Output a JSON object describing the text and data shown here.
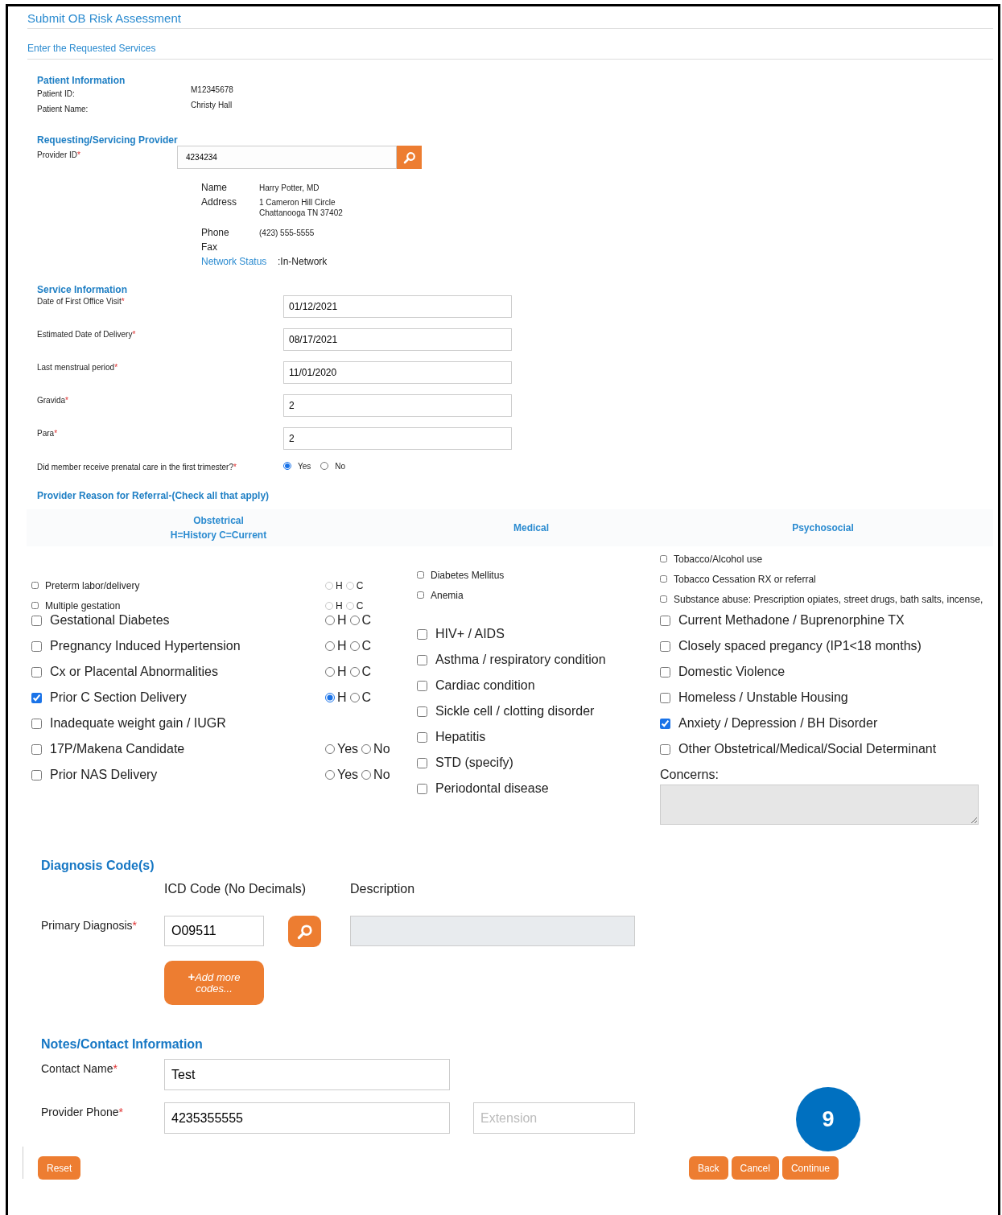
{
  "header": {
    "title": "Submit OB Risk Assessment",
    "subtitle": "Enter the Requested Services"
  },
  "patient": {
    "heading": "Patient Information",
    "fields": [
      {
        "label": "Patient ID:",
        "value": "M12345678"
      },
      {
        "label": "Patient Name:",
        "value": "Christy Hall"
      }
    ]
  },
  "provider": {
    "heading": "Requesting/Servicing Provider",
    "id_field": {
      "label": "Provider ID",
      "mark": "*",
      "value": "4234234"
    },
    "details": [
      {
        "kind": "plain",
        "label": "Name",
        "lines": [
          "Harry Potter, MD"
        ]
      },
      {
        "kind": "plain",
        "label": "Address",
        "lines": [
          "1 Cameron Hill Circle",
          "Chattanooga TN 37402"
        ]
      },
      {
        "kind": "plain",
        "label": "Phone",
        "lines": [
          "(423) 555-5555"
        ]
      },
      {
        "kind": "plain",
        "label": "Fax"
      },
      {
        "kind": "status",
        "label": "Network Status",
        "lines": [
          ":In-Network"
        ]
      }
    ]
  },
  "service": {
    "heading": "Service Information",
    "fields": [
      {
        "label": "Date of First Office Visit",
        "mark": "*",
        "value": "01/12/2021"
      },
      {
        "label": "Estimated Date of Delivery",
        "mark": "*",
        "value": "08/17/2021"
      },
      {
        "label": "Last menstrual period",
        "mark": "*",
        "value": "11/01/2020"
      },
      {
        "label": "Gravida",
        "mark": "*",
        "value": "2"
      },
      {
        "label": "Para",
        "mark": "*",
        "value": "2"
      }
    ],
    "question": {
      "label": "Did member receive prenatal care in the first trimester?",
      "mark": "*",
      "options": [
        {
          "label": "Yes",
          "selected": true
        },
        {
          "label": "No",
          "selected": false
        }
      ]
    }
  },
  "referral": {
    "heading": "Provider Reason for Referral-(Check all that apply)",
    "columns": [
      {
        "title_lines": [
          "Obstetrical",
          "H=History C=Current"
        ],
        "items": [
          {
            "kind": "small",
            "label": "Preterm labor/delivery",
            "checked": false,
            "options": [
              {
                "label": "H",
                "selected": false
              },
              {
                "label": "C",
                "selected": false
              }
            ]
          },
          {
            "kind": "small",
            "label": "Multiple gestation",
            "checked": false,
            "options": [
              {
                "label": "H",
                "selected": false
              },
              {
                "label": "C",
                "selected": false
              }
            ]
          },
          {
            "kind": "large",
            "label": "Gestational Diabetes",
            "checked": false,
            "options": [
              {
                "label": "H",
                "selected": false
              },
              {
                "label": "C",
                "selected": false
              }
            ]
          },
          {
            "kind": "large",
            "label": "Pregnancy Induced Hypertension",
            "checked": false,
            "options": [
              {
                "label": "H",
                "selected": false
              },
              {
                "label": "C",
                "selected": false
              }
            ]
          },
          {
            "kind": "large",
            "label": "Cx or Placental Abnormalities",
            "checked": false,
            "options": [
              {
                "label": "H",
                "selected": false
              },
              {
                "label": "C",
                "selected": false
              }
            ]
          },
          {
            "kind": "large",
            "label": "Prior C Section Delivery",
            "checked": true,
            "options": [
              {
                "label": "H",
                "selected": true
              },
              {
                "label": "C",
                "selected": false
              }
            ]
          },
          {
            "kind": "large",
            "label": "Inadequate weight gain / IUGR",
            "checked": false
          },
          {
            "kind": "large",
            "label": "17P/Makena Candidate",
            "checked": false,
            "options": [
              {
                "label": "Yes",
                "selected": false
              },
              {
                "label": "No",
                "selected": false
              }
            ]
          },
          {
            "kind": "large",
            "label": "Prior NAS Delivery",
            "checked": false,
            "options": [
              {
                "label": "Yes",
                "selected": false
              },
              {
                "label": "No",
                "selected": false
              }
            ]
          }
        ]
      },
      {
        "title_lines": [
          "Medical"
        ],
        "items": [
          {
            "kind": "small",
            "label": "Diabetes Mellitus",
            "checked": false
          },
          {
            "kind": "small",
            "label": "Anemia",
            "checked": false
          },
          {
            "kind": "large",
            "label": "HIV+ / AIDS",
            "checked": false
          },
          {
            "kind": "large",
            "label": "Asthma / respiratory condition",
            "checked": false
          },
          {
            "kind": "large",
            "label": "Cardiac condition",
            "checked": false
          },
          {
            "kind": "large",
            "label": "Sickle cell / clotting disorder",
            "checked": false
          },
          {
            "kind": "large",
            "label": "Hepatitis",
            "checked": false
          },
          {
            "kind": "large",
            "label": "STD (specify)",
            "checked": false
          },
          {
            "kind": "large",
            "label": "Periodontal disease",
            "checked": false
          }
        ]
      },
      {
        "title_lines": [
          "Psychosocial"
        ],
        "items": [
          {
            "kind": "small",
            "label": "Tobacco/Alcohol use",
            "checked": false
          },
          {
            "kind": "small",
            "label": "Tobacco Cessation RX or referral",
            "checked": false
          },
          {
            "kind": "small",
            "label": "Substance abuse: Prescription opiates, street drugs, bath salts, incense,",
            "checked": false
          },
          {
            "kind": "large",
            "label": "Current Methadone / Buprenorphine TX",
            "checked": false
          },
          {
            "kind": "large",
            "label": "Closely spaced pregancy (IP1<18 months)",
            "checked": false
          },
          {
            "kind": "large",
            "label": "Domestic Violence",
            "checked": false
          },
          {
            "kind": "large",
            "label": "Homeless / Unstable Housing",
            "checked": false
          },
          {
            "kind": "large",
            "label": "Anxiety / Depression / BH Disorder",
            "checked": true
          },
          {
            "kind": "large",
            "label": "Other Obstetrical/Medical/Social Determinant",
            "checked": false
          }
        ],
        "concerns_label": "Concerns:"
      }
    ]
  },
  "diagnosis": {
    "heading": "Diagnosis Code(s)",
    "columns": [
      "ICD Code (No Decimals)",
      "Description"
    ],
    "primary": {
      "label": "Primary Diagnosis",
      "mark": "*",
      "code": "O09511"
    },
    "add_button": {
      "plus": "+",
      "label": "Add more codes..."
    }
  },
  "notes": {
    "heading": "Notes/Contact Information",
    "fields": [
      {
        "label": "Contact Name",
        "mark": "*",
        "value": "Test"
      },
      {
        "label": "Provider Phone",
        "mark": "*",
        "value": "4235355555",
        "extension_placeholder": "Extension"
      }
    ]
  },
  "footer": {
    "left_buttons": [
      "Reset"
    ],
    "right_buttons": [
      "Back",
      "Cancel",
      "Continue"
    ]
  },
  "step_badge": "9"
}
